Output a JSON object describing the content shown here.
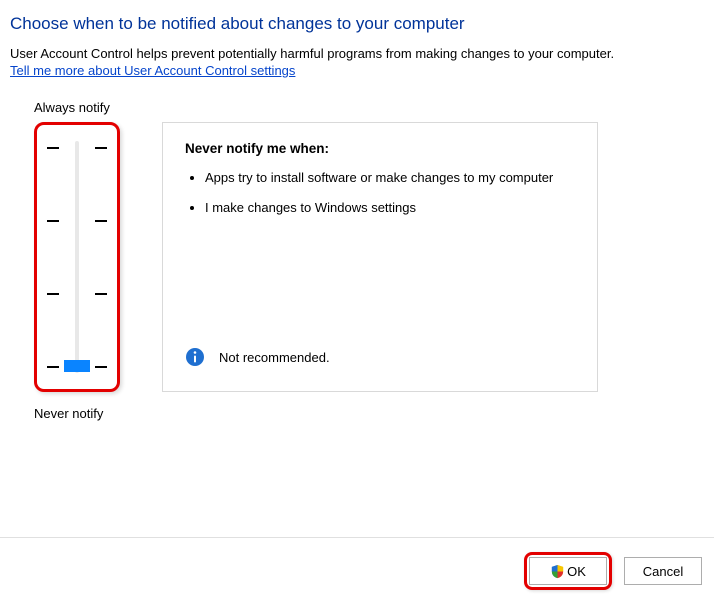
{
  "title": "Choose when to be notified about changes to your computer",
  "description": "User Account Control helps prevent potentially harmful programs from making changes to your computer.",
  "help_link": "Tell me more about User Account Control settings",
  "slider": {
    "top_label": "Always notify",
    "bottom_label": "Never notify"
  },
  "panel": {
    "heading": "Never notify me when:",
    "bullets": [
      "Apps try to install software or make changes to my computer",
      "I make changes to Windows settings"
    ],
    "note": "Not recommended."
  },
  "buttons": {
    "ok": "OK",
    "cancel": "Cancel"
  },
  "icons": {
    "info": "info-icon",
    "shield": "shield-icon"
  },
  "colors": {
    "title": "#003399",
    "link": "#0645cc",
    "highlight": "#e30000",
    "slider_thumb": "#0a84ff"
  }
}
